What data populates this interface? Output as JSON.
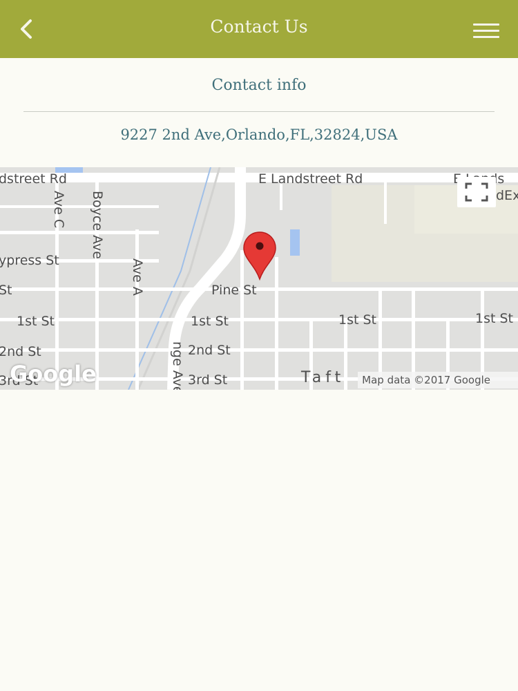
{
  "header": {
    "title": "Contact Us",
    "back_icon": "chevron-left-icon",
    "menu_icon": "hamburger-menu-icon"
  },
  "contact": {
    "section_title": "Contact info",
    "address": "9227 2nd Ave,Orlando,FL,32824,USA"
  },
  "map": {
    "labels": {
      "e_landstreet_left": "dstreet Rd",
      "e_landstreet_mid": "E Landstreet Rd",
      "e_landstreet_right": "E Lands",
      "poi_right": "dEx",
      "ave_c": "Ave C",
      "boyce_ave": "Boyce Ave",
      "ave_a": "Ave A",
      "cypress_st": "ypress St",
      "st_left": "St",
      "pine_st": "Pine St",
      "first_st_1": "1st St",
      "first_st_2": "1st St",
      "first_st_3": "1st St",
      "first_st_4": "1st St",
      "second_st_1": "2nd St",
      "second_st_2": "2nd St",
      "third_st_1": "3rd St",
      "third_st_2": "3rd St",
      "orange_ave": "nge Ave",
      "taft": "Taft"
    },
    "google_logo": "Google",
    "attribution": "Map data ©2017 Google",
    "fullscreen_icon": "fullscreen-icon",
    "pin_icon": "map-pin-icon",
    "pin_color": "#e53935"
  },
  "colors": {
    "header_bg": "#a1aa3b",
    "accent_text": "#3f6f7a",
    "page_bg": "#fbfbf5"
  }
}
